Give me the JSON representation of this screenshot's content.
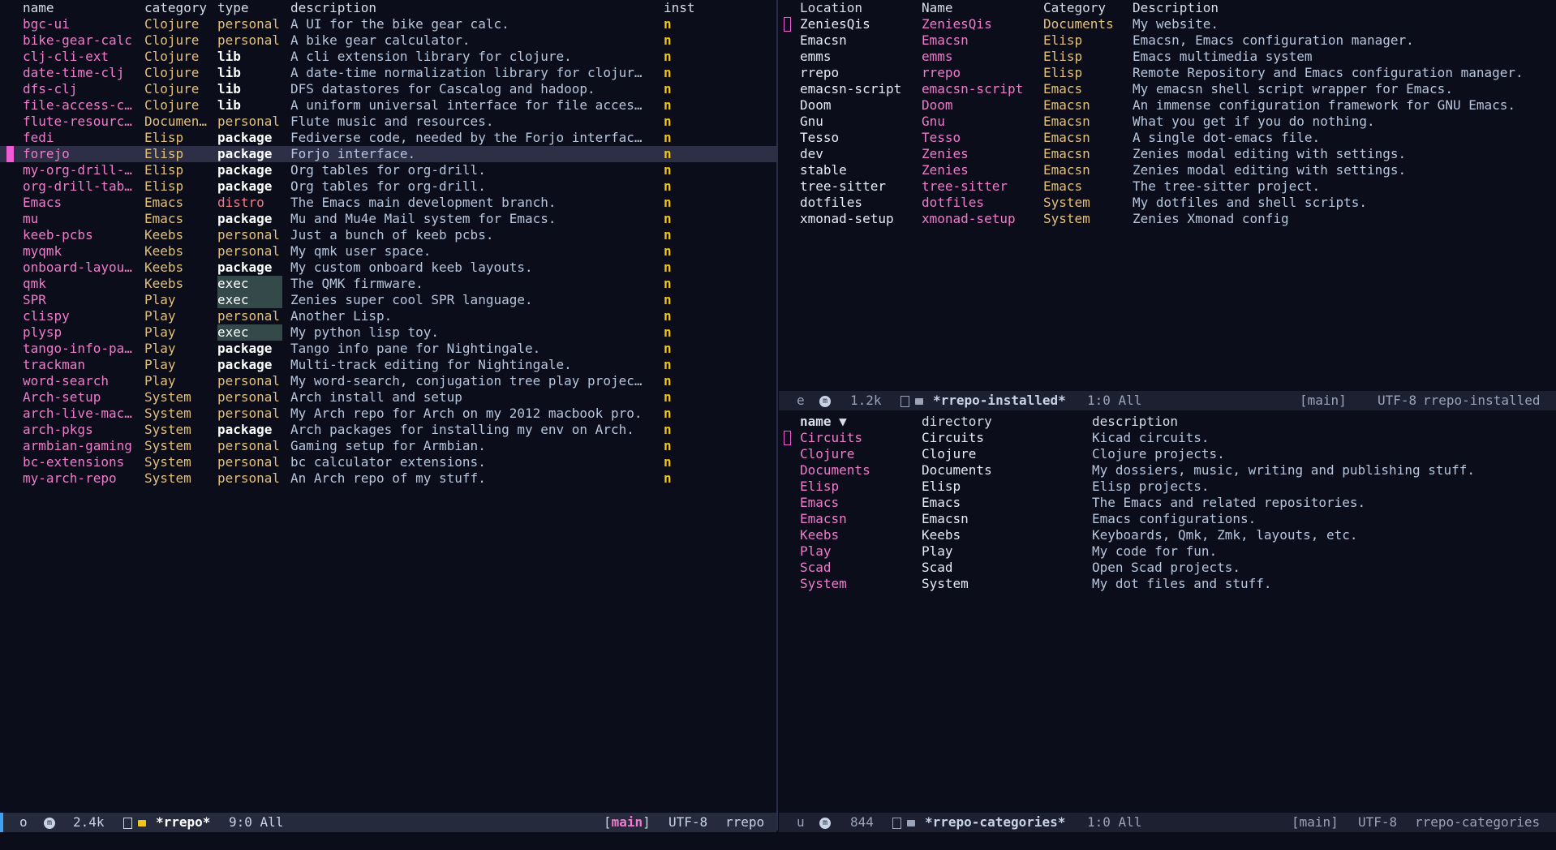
{
  "left": {
    "headers": {
      "name": "name",
      "category": "category",
      "type": "type",
      "description": "description",
      "inst": "inst"
    },
    "rows": [
      {
        "name": "bgc-ui",
        "category": "Clojure",
        "type": "personal",
        "description": "A UI for the bike gear calc.",
        "inst": "n"
      },
      {
        "name": "bike-gear-calc",
        "category": "Clojure",
        "type": "personal",
        "description": "A bike gear calculator.",
        "inst": "n"
      },
      {
        "name": "clj-cli-ext",
        "category": "Clojure",
        "type": "lib",
        "description": "A cli extension library for clojure.",
        "inst": "n"
      },
      {
        "name": "date-time-clj",
        "category": "Clojure",
        "type": "lib",
        "description": "A date-time normalization library for clojur…",
        "inst": "n"
      },
      {
        "name": "dfs-clj",
        "category": "Clojure",
        "type": "lib",
        "description": "DFS datastores for Cascalog and hadoop.",
        "inst": "n"
      },
      {
        "name": "file-access-c…",
        "category": "Clojure",
        "type": "lib",
        "description": "A uniform universal interface for file acces…",
        "inst": "n"
      },
      {
        "name": "flute-resourc…",
        "category": "Documen…",
        "type": "personal",
        "description": "Flute music and resources.",
        "inst": "n"
      },
      {
        "name": "fedi",
        "category": "Elisp",
        "type": "package",
        "description": "Fediverse code, needed by the Forjo interfac…",
        "inst": "n"
      },
      {
        "name": "forejo",
        "category": "Elisp",
        "type": "package",
        "description": "Forjo interface.",
        "inst": "n"
      },
      {
        "name": "my-org-drill-…",
        "category": "Elisp",
        "type": "package",
        "description": "Org tables for org-drill.",
        "inst": "n"
      },
      {
        "name": "org-drill-tab…",
        "category": "Elisp",
        "type": "package",
        "description": "Org tables for org-drill.",
        "inst": "n"
      },
      {
        "name": "Emacs",
        "category": "Emacs",
        "type": "distro",
        "description": "The Emacs main development branch.",
        "inst": "n"
      },
      {
        "name": "mu",
        "category": "Emacs",
        "type": "package",
        "description": "Mu and Mu4e Mail system for Emacs.",
        "inst": "n"
      },
      {
        "name": "keeb-pcbs",
        "category": "Keebs",
        "type": "personal",
        "description": "Just a bunch of keeb pcbs.",
        "inst": "n"
      },
      {
        "name": "myqmk",
        "category": "Keebs",
        "type": "personal",
        "description": "My qmk user space.",
        "inst": "n"
      },
      {
        "name": "onboard-layou…",
        "category": "Keebs",
        "type": "package",
        "description": "My custom onboard keeb layouts.",
        "inst": "n"
      },
      {
        "name": "qmk",
        "category": "Keebs",
        "type": "exec",
        "description": "The QMK firmware.",
        "inst": "n"
      },
      {
        "name": "SPR",
        "category": "Play",
        "type": "exec",
        "description": "Zenies super cool SPR language.",
        "inst": "n"
      },
      {
        "name": "clispy",
        "category": "Play",
        "type": "personal",
        "description": "Another Lisp.",
        "inst": "n"
      },
      {
        "name": "plysp",
        "category": "Play",
        "type": "exec",
        "description": "My python lisp toy.",
        "inst": "n"
      },
      {
        "name": "tango-info-pa…",
        "category": "Play",
        "type": "package",
        "description": "Tango info pane for Nightingale.",
        "inst": "n"
      },
      {
        "name": "trackman",
        "category": "Play",
        "type": "package",
        "description": "Multi-track editing for Nightingale.",
        "inst": "n"
      },
      {
        "name": "word-search",
        "category": "Play",
        "type": "personal",
        "description": "My word-search, conjugation tree play projec…",
        "inst": "n"
      },
      {
        "name": "Arch-setup",
        "category": "System",
        "type": "personal",
        "description": "Arch install and setup",
        "inst": "n"
      },
      {
        "name": "arch-live-mac…",
        "category": "System",
        "type": "personal",
        "description": "My Arch repo for Arch on my 2012 macbook pro.",
        "inst": "n"
      },
      {
        "name": "arch-pkgs",
        "category": "System",
        "type": "package",
        "description": "Arch packages for installing my env on Arch.",
        "inst": "n"
      },
      {
        "name": "armbian-gaming",
        "category": "System",
        "type": "personal",
        "description": "Gaming setup for Armbian.",
        "inst": "n"
      },
      {
        "name": "bc-extensions",
        "category": "System",
        "type": "personal",
        "description": "bc calculator extensions.",
        "inst": "n"
      },
      {
        "name": "my-arch-repo",
        "category": "System",
        "type": "personal",
        "description": "An Arch repo of my stuff.",
        "inst": "n"
      }
    ],
    "selected_index": 8
  },
  "right_top": {
    "headers": {
      "location": "Location",
      "name": "Name",
      "category": "Category",
      "description": "Description"
    },
    "rows": [
      {
        "location": "ZeniesQis",
        "name": "ZeniesQis",
        "category": "Documents",
        "description": "My website."
      },
      {
        "location": "Emacsn",
        "name": "Emacsn",
        "category": "Elisp",
        "description": "Emacsn, Emacs configuration manager."
      },
      {
        "location": "emms",
        "name": "emms",
        "category": "Elisp",
        "description": "Emacs multimedia system"
      },
      {
        "location": "rrepo",
        "name": "rrepo",
        "category": "Elisp",
        "description": "Remote Repository and Emacs configuration manager."
      },
      {
        "location": "emacsn-script",
        "name": "emacsn-script",
        "category": "Emacs",
        "description": "My emacsn shell script wrapper for Emacs."
      },
      {
        "location": "Doom",
        "name": "Doom",
        "category": "Emacsn",
        "description": "An immense configuration framework for GNU Emacs."
      },
      {
        "location": "Gnu",
        "name": "Gnu",
        "category": "Emacsn",
        "description": "What you get if you do nothing."
      },
      {
        "location": "Tesso",
        "name": "Tesso",
        "category": "Emacsn",
        "description": "A single dot-emacs file."
      },
      {
        "location": "dev",
        "name": "Zenies",
        "category": "Emacsn",
        "description": "Zenies modal editing with settings."
      },
      {
        "location": "stable",
        "name": "Zenies",
        "category": "Emacsn",
        "description": "Zenies modal editing with settings."
      },
      {
        "location": "tree-sitter",
        "name": "tree-sitter",
        "category": "Emacs",
        "description": "The tree-sitter project."
      },
      {
        "location": "dotfiles",
        "name": "dotfiles",
        "category": "System",
        "description": "My dotfiles and shell scripts."
      },
      {
        "location": "xmonad-setup",
        "name": "xmonad-setup",
        "category": "System",
        "description": "Zenies Xmonad config"
      }
    ]
  },
  "right_bottom": {
    "headers": {
      "name": "name ▼",
      "directory": "directory",
      "description": "description"
    },
    "rows": [
      {
        "name": "Circuits",
        "directory": "Circuits",
        "description": "Kicad circuits."
      },
      {
        "name": "Clojure",
        "directory": "Clojure",
        "description": "Clojure projects."
      },
      {
        "name": "Documents",
        "directory": "Documents",
        "description": "My dossiers, music, writing and publishing stuff."
      },
      {
        "name": "Elisp",
        "directory": "Elisp",
        "description": "Elisp projects."
      },
      {
        "name": "Emacs",
        "directory": "Emacs",
        "description": "The Emacs and related repositories."
      },
      {
        "name": "Emacsn",
        "directory": "Emacsn",
        "description": "Emacs configurations."
      },
      {
        "name": "Keebs",
        "directory": "Keebs",
        "description": "Keyboards, Qmk, Zmk, layouts, etc."
      },
      {
        "name": "Play",
        "directory": "Play",
        "description": "My code for fun."
      },
      {
        "name": "Scad",
        "directory": "Scad",
        "description": "Open Scad projects."
      },
      {
        "name": "System",
        "directory": "System",
        "description": "My dot files and stuff."
      }
    ]
  },
  "modelines": {
    "left": {
      "state": "o",
      "icon": "m",
      "size": "2.4k",
      "buffer": "*rrepo*",
      "position": "9:0 All",
      "branch": "main",
      "encoding": "UTF-8",
      "mode": "rrepo"
    },
    "right_top": {
      "state": "e",
      "icon": "m",
      "size": "1.2k",
      "buffer": "*rrepo-installed*",
      "position": "1:0 All",
      "branch": "[main]",
      "encoding": "UTF-8",
      "mode": "rrepo-installed"
    },
    "right_bottom": {
      "state": "u",
      "icon": "m",
      "size": "844",
      "buffer": "*rrepo-categories*",
      "position": "1:0 All",
      "branch": "[main]",
      "encoding": "UTF-8",
      "mode": "rrepo-categories"
    }
  }
}
